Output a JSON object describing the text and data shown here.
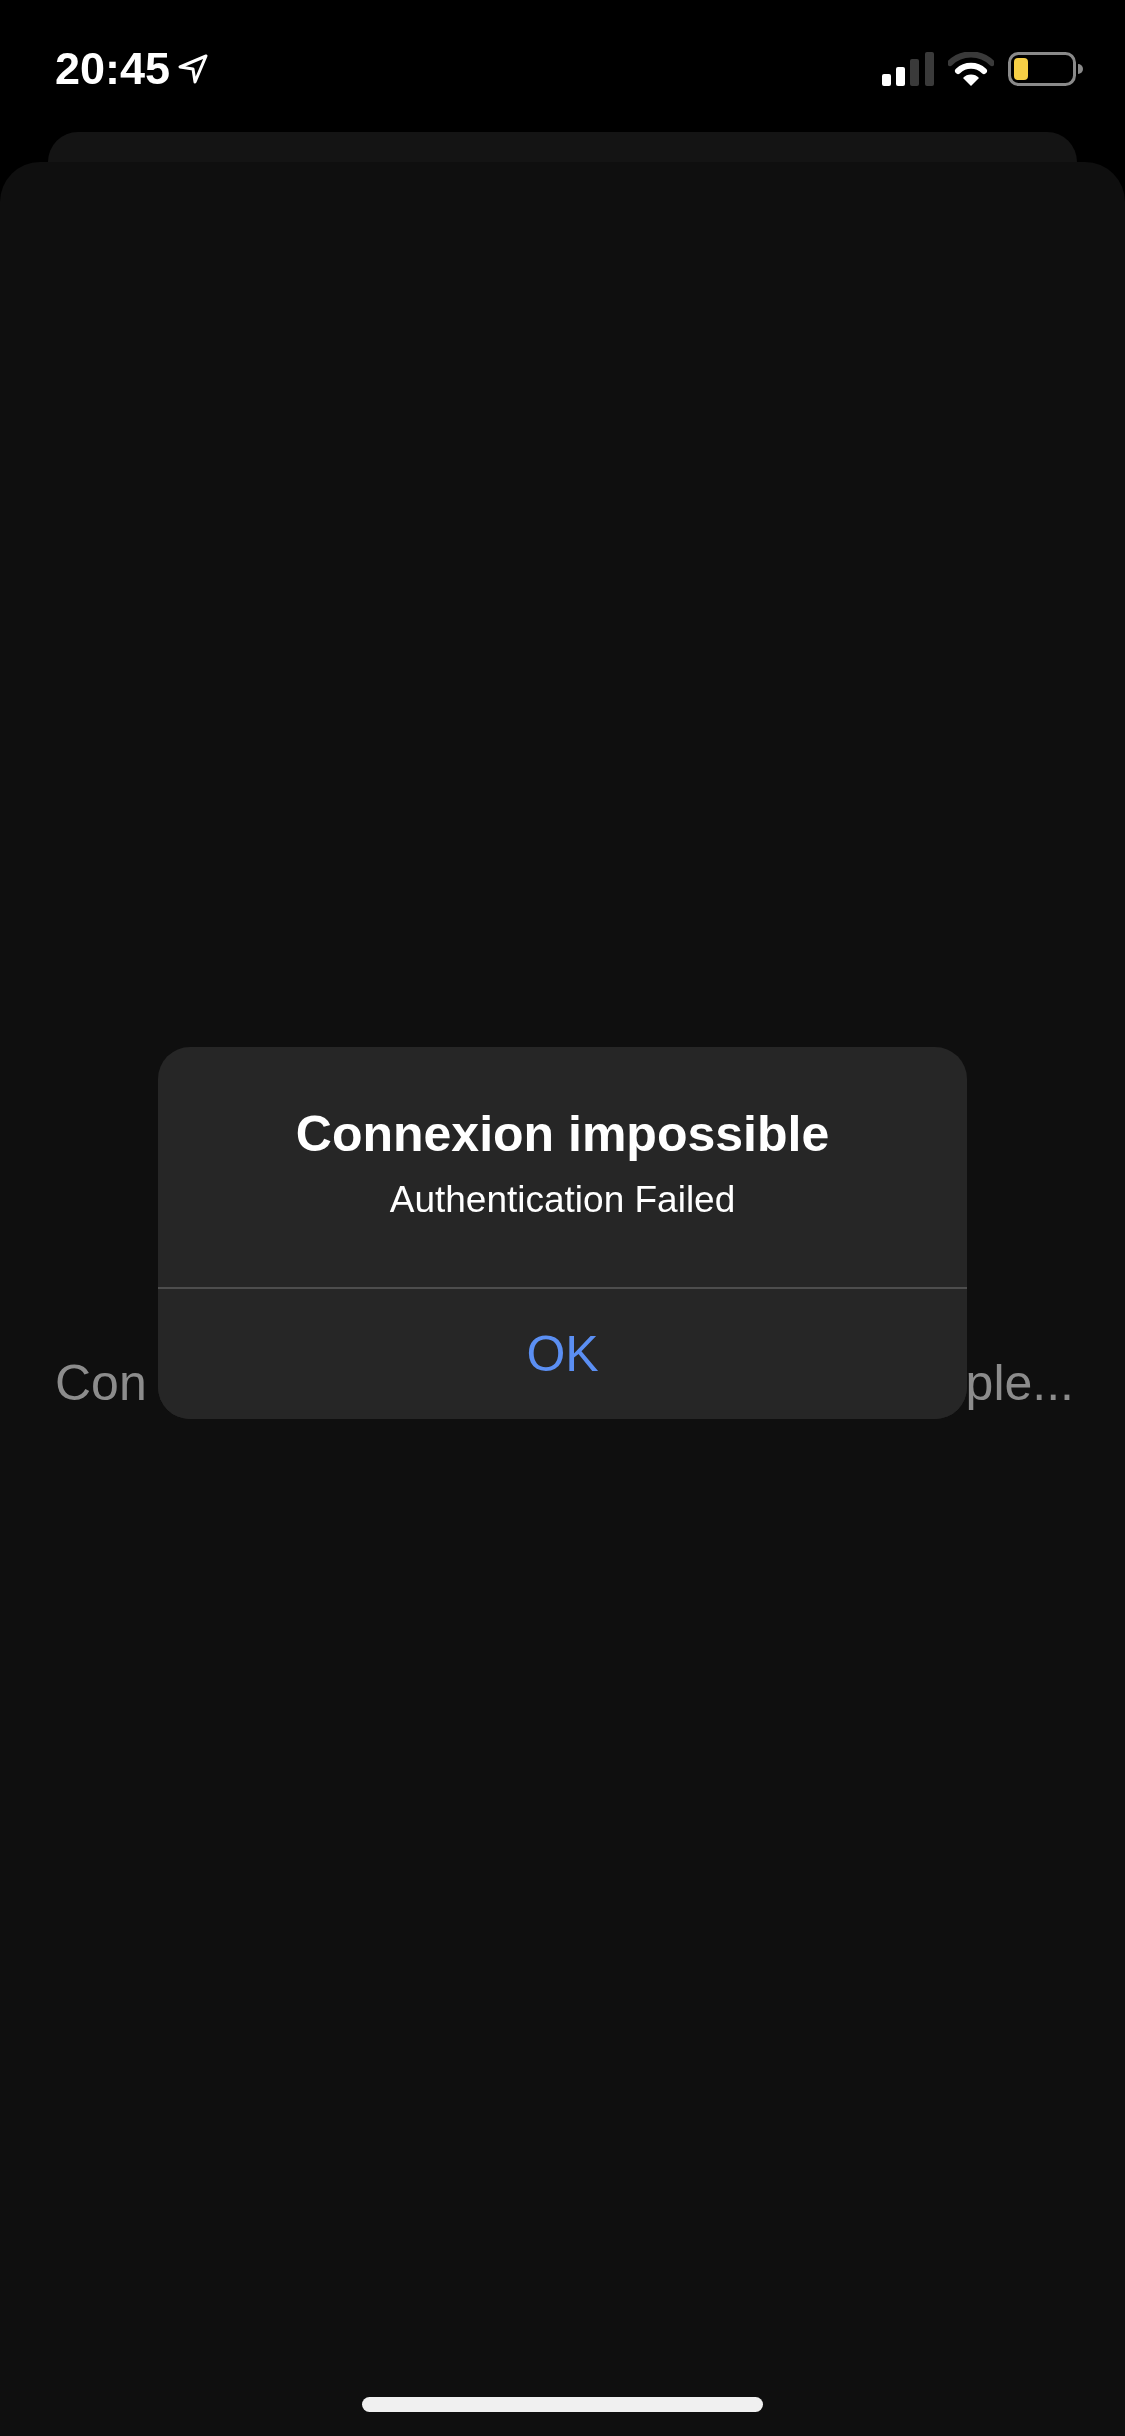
{
  "status_bar": {
    "time": "20:45"
  },
  "background_text": {
    "left_part": "Con",
    "right_part": "ple..."
  },
  "alert": {
    "title": "Connexion impossible",
    "message": "Authentication Failed",
    "buttons": [
      "OK"
    ]
  }
}
